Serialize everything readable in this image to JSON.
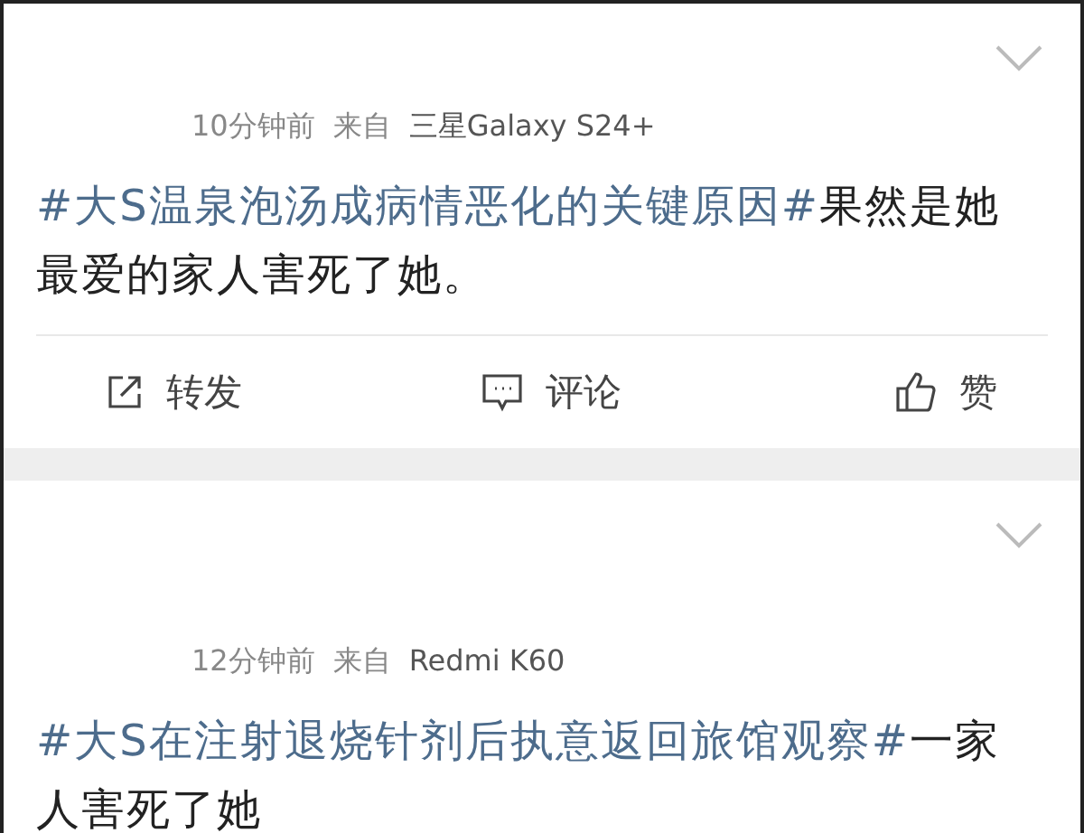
{
  "posts": [
    {
      "time": "10分钟前",
      "source_label": "来自",
      "device": "三星Galaxy S24+",
      "topic": "#大S温泉泡汤成病情恶化的关键原因#",
      "text": "果然是她最爱的家人害死了她。",
      "actions": [
        {
          "kind": "repost",
          "label": "转发"
        },
        {
          "kind": "comment",
          "label": "评论"
        },
        {
          "kind": "like",
          "label": "赞"
        }
      ]
    },
    {
      "time": "12分钟前",
      "source_label": "来自",
      "device": "Redmi K60",
      "topic": "#大S在注射退烧针剂后执意返回旅馆观察#",
      "text": "一家人害死了她"
    }
  ]
}
